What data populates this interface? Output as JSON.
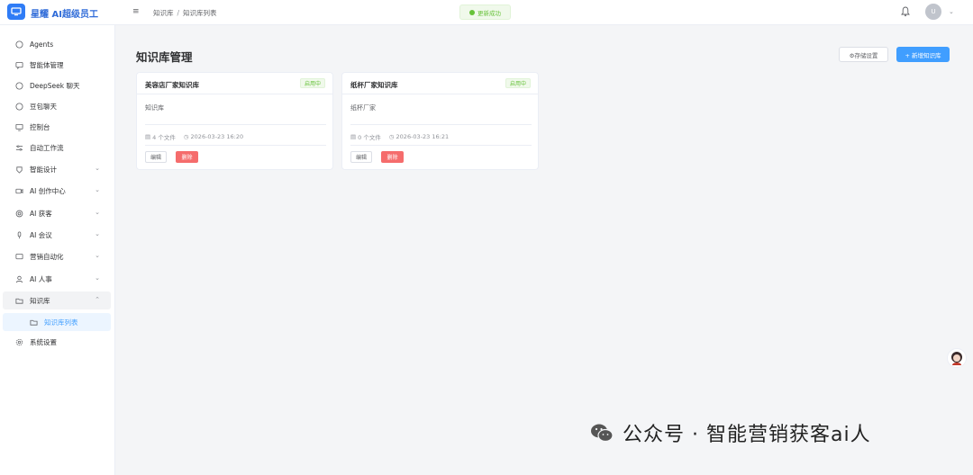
{
  "app": {
    "title": "星耀 AI超级员工"
  },
  "header": {
    "breadcrumb": [
      "知识库",
      "知识库列表"
    ],
    "toast": "更新成功",
    "avatar_initial": "U"
  },
  "sidebar": {
    "items": [
      {
        "label": "Agents",
        "icon": "chat-bubble-icon",
        "expandable": false
      },
      {
        "label": "智能体管理",
        "icon": "message-square-icon",
        "expandable": false
      },
      {
        "label": "DeepSeek 聊天",
        "icon": "chat-bubble-icon",
        "expandable": false
      },
      {
        "label": "豆包聊天",
        "icon": "chat-bubble-icon",
        "expandable": false
      },
      {
        "label": "控制台",
        "icon": "monitor-icon",
        "expandable": false
      },
      {
        "label": "自动工作流",
        "icon": "sliders-icon",
        "expandable": false
      },
      {
        "label": "智能设计",
        "icon": "palette-icon",
        "expandable": true
      },
      {
        "label": "AI 创作中心",
        "icon": "video-icon",
        "expandable": true
      },
      {
        "label": "AI 获客",
        "icon": "target-icon",
        "expandable": true
      },
      {
        "label": "AI 会议",
        "icon": "microphone-icon",
        "expandable": true
      },
      {
        "label": "营销自动化",
        "icon": "message-square-icon",
        "expandable": true
      },
      {
        "label": "AI 人事",
        "icon": "user-icon",
        "expandable": true
      },
      {
        "label": "知识库",
        "icon": "folder-icon",
        "expandable": true,
        "open": true
      },
      {
        "label": "知识库列表",
        "icon": "folder-icon",
        "sub": true,
        "active": true
      },
      {
        "label": "系统设置",
        "icon": "gear-icon",
        "expandable": false
      }
    ]
  },
  "main": {
    "title": "知识库管理",
    "settings_button": "⚙存储设置",
    "new_button": "+ 新增知识库",
    "cards": [
      {
        "title": "美容店厂家知识库",
        "status": "启用中",
        "description": "知识库",
        "files": "4 个文件",
        "time": "2026-03-23 16:20",
        "edit": "编辑",
        "delete": "删除"
      },
      {
        "title": "纸杯厂家知识库",
        "status": "启用中",
        "description": "纸杯厂家",
        "files": "0 个文件",
        "time": "2026-03-23 16:21",
        "edit": "编辑",
        "delete": "删除"
      }
    ]
  },
  "watermark": {
    "text": "公众号 · 智能营销获客ai人"
  },
  "colors": {
    "primary": "#409eff",
    "success": "#67c23a",
    "danger": "#f56c6c",
    "brand": "#2f7cf6"
  }
}
